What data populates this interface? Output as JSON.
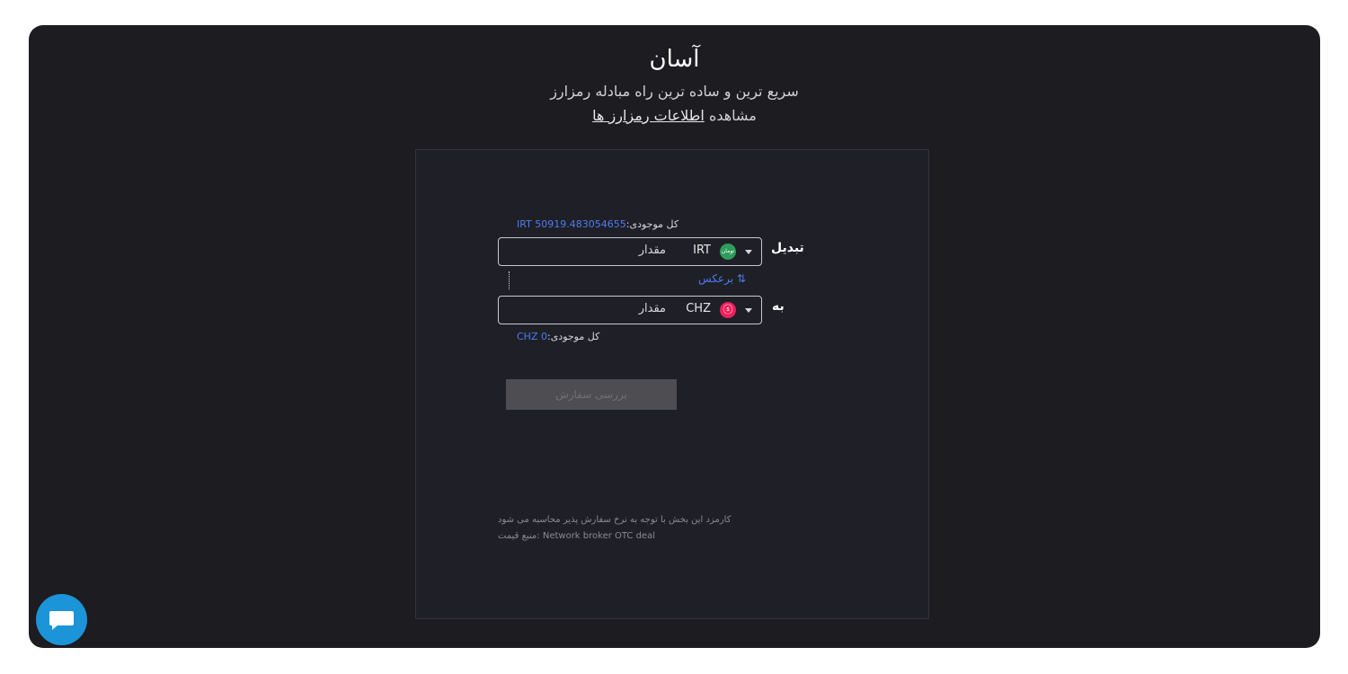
{
  "header": {
    "title": "آسان",
    "subtitle": "سریع ترین و ساده ترین راه مبادله رمزارز",
    "view_prefix": "مشاهده",
    "view_link": "اطلاعات رمزارز ها"
  },
  "form": {
    "from": {
      "balance_label": "کل موجودی:",
      "balance_value": "IRT 50919.483054655",
      "label": "تبدیل",
      "placeholder": "مقدار",
      "currency": "IRT",
      "coin_text": "تومان",
      "coin_color": "#2e9d5a"
    },
    "swap_label": "برعکس",
    "swap_icon": "⇅",
    "to": {
      "label": "به",
      "placeholder": "مقدار",
      "currency": "CHZ",
      "coin_text": "ⓢ",
      "coin_color": "#f01f5b",
      "balance_label": "کل موجودی:",
      "balance_value": "CHZ 0"
    },
    "submit_label": "بررسی سفارش",
    "fee_note": "کارمزد این بخش با توجه به نرخ سفارش پذیر محاسبه می شود",
    "price_source": "منبع قیمت: Network broker OTC deal"
  },
  "chat": {
    "icon": "chat-bubble-icon",
    "color": "#1c94d8"
  }
}
